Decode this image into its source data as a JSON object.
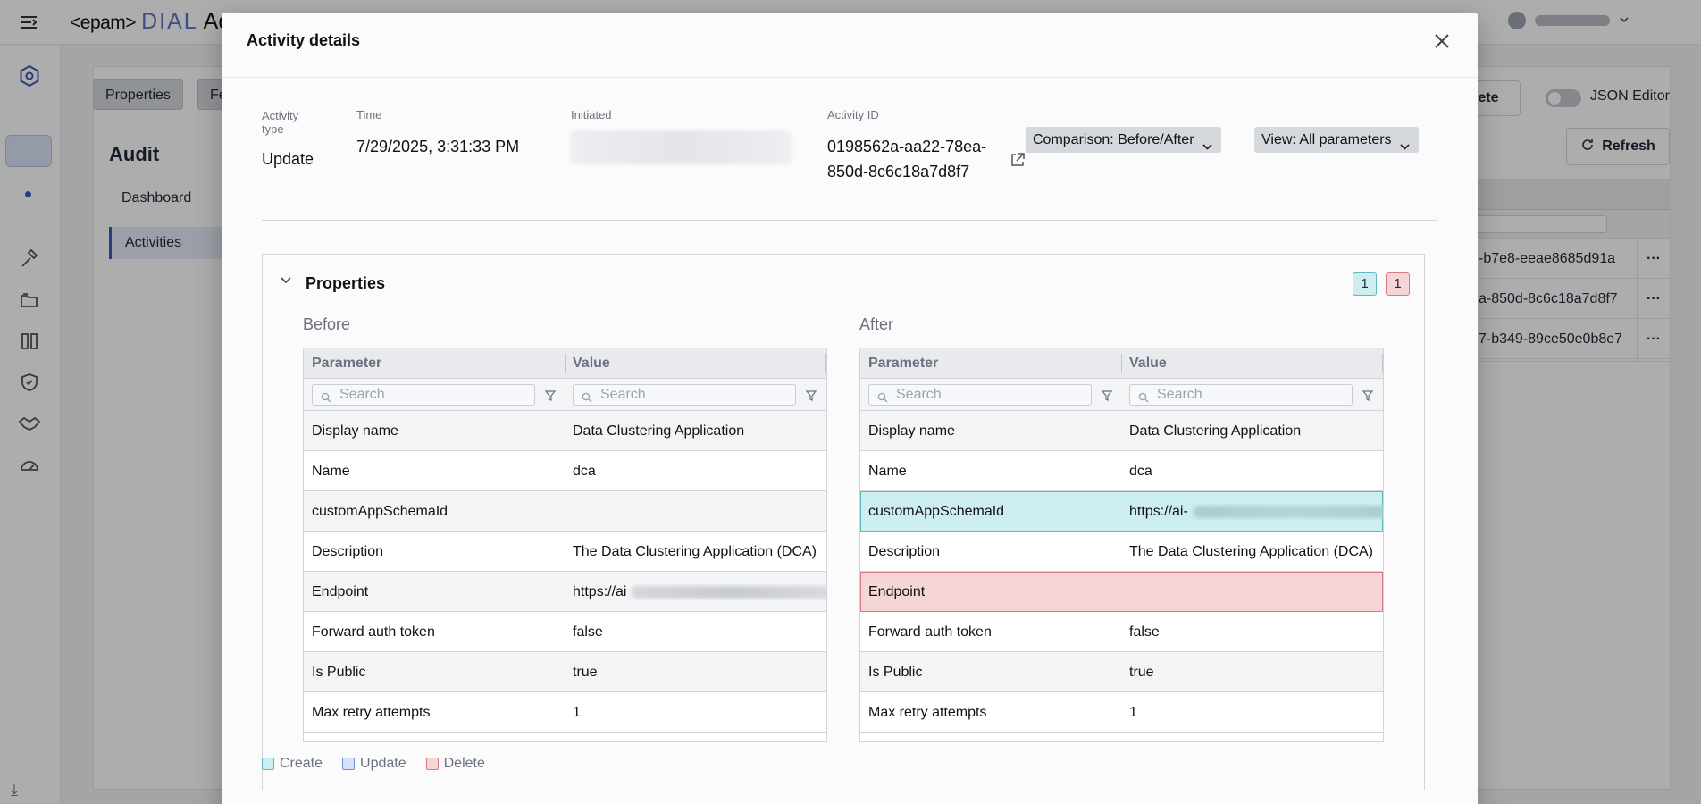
{
  "app": {
    "logo_epam": "<epam>",
    "logo_dial": "DIAL",
    "logo_suffix": "Adm",
    "tabs": [
      "Properties",
      "Fe"
    ],
    "page_title": "Audit",
    "nav": [
      {
        "label": "Dashboard"
      },
      {
        "label": "Activities"
      }
    ],
    "delete_label": "elete",
    "json_editor_label": "JSON Editor",
    "refresh_label": "Refresh",
    "bg_rows": [
      "-b7e8-eeae8685d91a",
      "a-850d-8c6c18a7d8f7",
      "7-b349-89ce50e0b8e7"
    ]
  },
  "modal": {
    "title": "Activity details",
    "meta": {
      "type_label": "Activity type",
      "type_value": "Update",
      "time_label": "Time",
      "time_value": "7/29/2025, 3:31:33 PM",
      "initiated_label": "Initiated",
      "activity_id_label": "Activity ID",
      "activity_id_value_line1": "0198562a-aa22-78ea-",
      "activity_id_value_line2": "850d-8c6c18a7d8f7"
    },
    "comparison_dropdown": "Comparison: Before/After",
    "view_dropdown": "View: All parameters",
    "section_title": "Properties",
    "badge_create": "1",
    "badge_delete": "1",
    "before_title": "Before",
    "after_title": "After",
    "col_parameter": "Parameter",
    "col_value": "Value",
    "search_placeholder": "Search",
    "before_rows": [
      {
        "param": "Display name",
        "value": "Data Clustering Application"
      },
      {
        "param": "Name",
        "value": "dca"
      },
      {
        "param": "customAppSchemaId",
        "value": ""
      },
      {
        "param": "Description",
        "value": "The Data Clustering Application (DCA)"
      },
      {
        "param": "Endpoint",
        "value": "https://ai"
      },
      {
        "param": "Forward auth token",
        "value": "false"
      },
      {
        "param": "Is Public",
        "value": "true"
      },
      {
        "param": "Max retry attempts",
        "value": "1"
      }
    ],
    "after_rows": [
      {
        "param": "Display name",
        "value": "Data Clustering Application"
      },
      {
        "param": "Name",
        "value": "dca"
      },
      {
        "param": "customAppSchemaId",
        "value": "https://ai-"
      },
      {
        "param": "Description",
        "value": "The Data Clustering Application (DCA)"
      },
      {
        "param": "Endpoint",
        "value": ""
      },
      {
        "param": "Forward auth token",
        "value": "false"
      },
      {
        "param": "Is Public",
        "value": "true"
      },
      {
        "param": "Max retry attempts",
        "value": "1"
      }
    ],
    "legend": {
      "create": "Create",
      "update": "Update",
      "delete": "Delete"
    }
  },
  "colors": {
    "create": "#cdeef0",
    "update": "#d7e2f7",
    "delete": "#f6d5d7",
    "accent": "#3d5bb8"
  }
}
